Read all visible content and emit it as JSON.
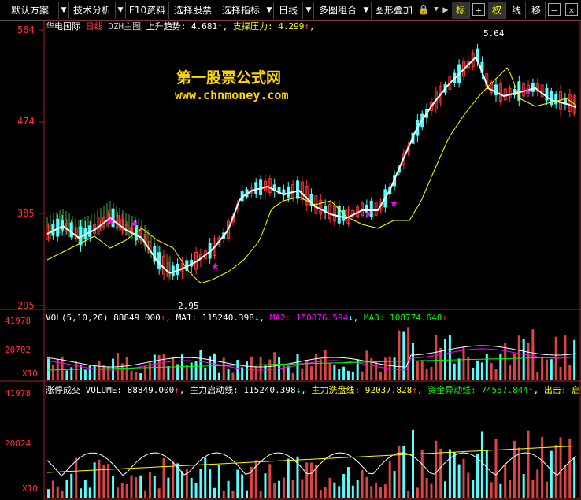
{
  "toolbar": {
    "items": [
      {
        "label": "默认方案"
      },
      {
        "label": "技术分析"
      },
      {
        "label": "F10资料"
      },
      {
        "label": "选择股票"
      },
      {
        "label": "选择指标"
      },
      {
        "label": "日线"
      },
      {
        "label": "多图组合"
      },
      {
        "label": "图形叠加"
      }
    ],
    "right": {
      "biao": "标",
      "quan": "权",
      "xian": "线",
      "yi": "移"
    }
  },
  "main_chart": {
    "stock": "华电国际",
    "period": "日线",
    "indicator": "DZH主图",
    "trend_label": "上升趋势: 4.681",
    "support_label": "支撑压力: 4.299",
    "watermark_title": "第一股票公式网",
    "watermark_url": "www.chnmoney.com",
    "y_ticks": [
      "564",
      "474",
      "385",
      "295"
    ],
    "high_label": "5.64",
    "low_label": "2.95",
    "buy_label": "买"
  },
  "vol_panel": {
    "header_vol": "VOL(5,10,20) 88849.000",
    "ma1": "MA1: 115240.398",
    "ma2": "MA2: 150876.594",
    "ma3": "MA3: 108774.648",
    "y_ticks": [
      "41978",
      "20702"
    ],
    "multiplier": "X10"
  },
  "zt_panel": {
    "title": "涨停成交",
    "volume": "VOLUME: 88849.000",
    "zhuli": "主力启动线: 115240.398",
    "xipan": "主力洗盘线: 92037.828",
    "yidong": "资金异动线: 74557.844",
    "chuji": "出击: 启动:",
    "y_ticks": [
      "41978",
      "20824"
    ],
    "multiplier": "X10"
  },
  "colors": {
    "up": "#ff3232",
    "down": "#54ffff",
    "ma_white": "#ffffff",
    "ma_yellow": "#ffff00",
    "ma_magenta": "#ff00ff",
    "ma_green": "#00ff00"
  }
}
